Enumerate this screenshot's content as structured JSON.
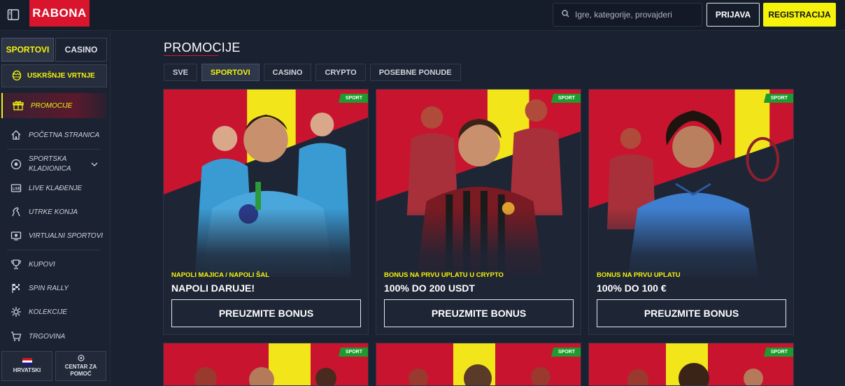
{
  "header": {
    "logo_text": "RABONA",
    "search_placeholder": "Igre, kategorije, provajderi",
    "login_label": "PRIJAVA",
    "register_label": "REGISTRACIJA"
  },
  "sidebar": {
    "tabs": [
      {
        "label": "SPORTOVI",
        "active": true
      },
      {
        "label": "CASINO",
        "active": false
      }
    ],
    "easter_label": "USKRŠNJE VRTNJE",
    "items": [
      {
        "label": "PROMOCIJE",
        "icon": "gift-icon",
        "active": true
      },
      {
        "label": "POČETNA STRANICA",
        "icon": "home-icon"
      },
      {
        "label": "SPORTSKA KLADIONICA",
        "icon": "soccer-ball-icon"
      },
      {
        "label": "LIVE KLAĐENJE",
        "icon": "live-icon"
      },
      {
        "label": "UTRKE KONJA",
        "icon": "horse-icon"
      },
      {
        "label": "VIRTUALNI SPORTOVI",
        "icon": "virtual-sports-icon"
      },
      {
        "label": "KUPOVI",
        "icon": "trophy-icon"
      },
      {
        "label": "SPIN RALLY",
        "icon": "rally-flag-icon"
      },
      {
        "label": "KOLEKCIJE",
        "icon": "collections-icon"
      },
      {
        "label": "TRGOVINA",
        "icon": "cart-icon"
      }
    ],
    "language_label": "HRVATSKI",
    "help_label": "CENTAR ZA POMOĆ"
  },
  "main": {
    "title": "PROMOCIJE",
    "filters": [
      {
        "label": "SVE",
        "active": false
      },
      {
        "label": "SPORTOVI",
        "active": true
      },
      {
        "label": "CASINO",
        "active": false
      },
      {
        "label": "CRYPTO",
        "active": false
      },
      {
        "label": "POSEBNE PONUDE",
        "active": false
      }
    ],
    "cards": [
      {
        "badge": "SPORT",
        "subtitle": "NAPOLI MAJICA / NAPOLI ŠAL",
        "headline": "NAPOLI DARUJE!",
        "cta": "PREUZMITE BONUS"
      },
      {
        "badge": "SPORT",
        "subtitle": "BONUS NA PRVU UPLATU U CRYPTO",
        "headline": "100% DO 200 USDT",
        "cta": "PREUZMITE BONUS"
      },
      {
        "badge": "SPORT",
        "subtitle": "BONUS NA PRVU UPLATU",
        "headline": "100% DO 100 €",
        "cta": "PREUZMITE BONUS"
      }
    ],
    "lower_cards": [
      {
        "badge": "SPORT"
      },
      {
        "badge": "SPORT"
      },
      {
        "badge": "SPORT"
      }
    ]
  },
  "colors": {
    "accent_yellow": "#f5f30c",
    "brand_red": "#d9142d",
    "badge_green": "#1f9a2e",
    "background": "#1a2130"
  }
}
